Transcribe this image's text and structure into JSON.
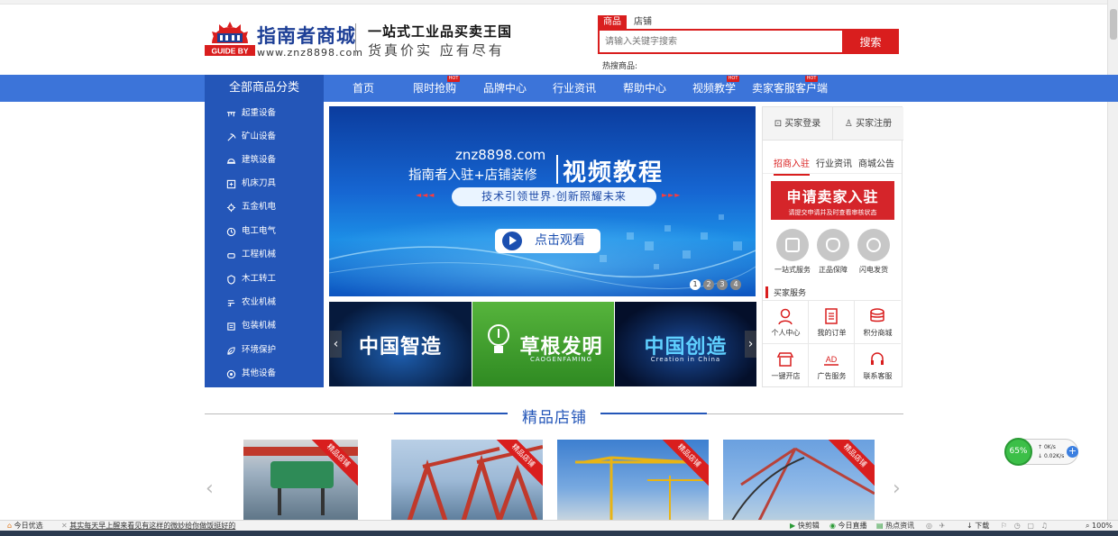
{
  "site": {
    "name": "指南者商城",
    "url": "www.znz8898.com",
    "logo_text": "GUIDE BY",
    "slogan_main": "一站式工业品买卖王国",
    "slogan_sub": "货真价实 应有尽有"
  },
  "search": {
    "tabs": [
      "商品",
      "店铺"
    ],
    "active_tab": "商品",
    "placeholder": "请输入关键字搜索",
    "button": "搜索",
    "hot_label": "热搜商品:"
  },
  "nav": {
    "all_categories": "全部商品分类",
    "items": [
      {
        "label": "首页",
        "hot": false
      },
      {
        "label": "限时抢购",
        "hot": true
      },
      {
        "label": "品牌中心",
        "hot": false
      },
      {
        "label": "行业资讯",
        "hot": false
      },
      {
        "label": "帮助中心",
        "hot": false
      },
      {
        "label": "视频教学",
        "hot": true
      },
      {
        "label": "卖家客服客户端",
        "hot": true
      }
    ],
    "hot_badge": "HOT"
  },
  "categories": [
    "起重设备",
    "矿山设备",
    "建筑设备",
    "机床刀具",
    "五金机电",
    "电工电气",
    "工程机械",
    "木工转工",
    "农业机械",
    "包装机械",
    "环境保护",
    "其他设备"
  ],
  "banner": {
    "url_text": "znz8898.com",
    "line1": "指南者入驻+店铺装修",
    "big_text": "视频教程",
    "pill_text": "技术引领世界·创新照耀未来",
    "watch_button": "点击观看",
    "arrows_left": "◄◄◄",
    "arrows_right": "►►►",
    "dots": [
      "1",
      "2",
      "3",
      "4"
    ],
    "active_dot": "1"
  },
  "tiles": [
    {
      "title": "中国智造",
      "subtitle": "",
      "color": "#0a2a55"
    },
    {
      "title": "草根发明",
      "subtitle": "CAOGENFAMING",
      "color": "#3f9b2e"
    },
    {
      "title": "中国创造",
      "subtitle": "Creation in China",
      "color": "#0a1f4a"
    }
  ],
  "account": {
    "login": "买家登录",
    "register": "买家注册",
    "tabs": [
      "招商入驻",
      "行业资讯",
      "商城公告"
    ],
    "active_tab": "招商入驻",
    "apply_title": "申请卖家入驻",
    "apply_sub": "请提交申请并及时查看审核状态",
    "features": [
      "一站式服务",
      "正品保障",
      "闪电发货"
    ],
    "services_title": "买家服务",
    "services": [
      "个人中心",
      "我的订单",
      "积分商城",
      "一键开店",
      "广告服务",
      "联系客服"
    ]
  },
  "section": {
    "title": "精品店铺",
    "ribbon": "精品店铺"
  },
  "shops": [
    {
      "name": "hoist",
      "color": "#6a7f92"
    },
    {
      "name": "port-crane",
      "color": "#b94238"
    },
    {
      "name": "tower-crane-1",
      "color": "#4b7bbd"
    },
    {
      "name": "tower-crane-2",
      "color": "#6a9ad6"
    }
  ],
  "speed_widget": {
    "percent": "65%",
    "up": "0K/s",
    "down": "0.02K/s",
    "plus": "+"
  },
  "statusbar": {
    "left_label": "今日优选",
    "news": "其实每天早上醒来看见有这样的微妙给你做饭挺好的",
    "items": [
      "快剪辑",
      "今日直播",
      "热点资讯",
      "下载"
    ],
    "zoom": "100%"
  },
  "colors": {
    "brand_blue": "#2456b8",
    "nav_blue": "#3c74d9",
    "accent_red": "#d91e1e"
  }
}
